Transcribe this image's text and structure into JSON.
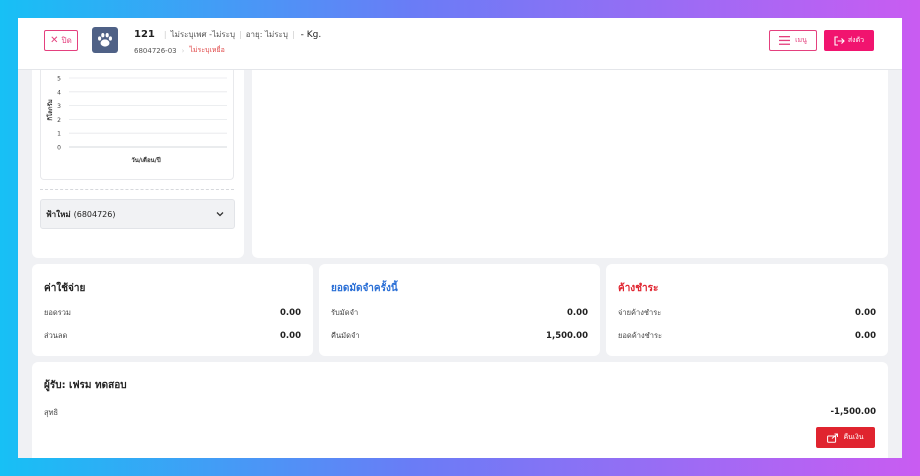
{
  "header": {
    "close_label": "ปิด",
    "pet_number": "121",
    "pet_gender": "ไม่ระบุเพศ -ไม่ระบุ",
    "pet_age": "อายุ: ไม่ระบุ",
    "pet_weight": "- Kg.",
    "pet_code": "6804726-03",
    "pet_status": "ไม่ระบุเหยื่อ",
    "menu_label": "เมนู",
    "send_label": "ส่งตัว"
  },
  "weight_chart": {
    "ylabel": "กิโลกรัม",
    "xlabel": "วัน/เดือน/ปี",
    "ticks": [
      "5",
      "4",
      "3",
      "2",
      "1",
      "0"
    ]
  },
  "chart_data": {
    "type": "line",
    "title": "",
    "xlabel": "วัน/เดือน/ปี",
    "ylabel": "กิโลกรัม",
    "ylim": [
      0,
      5
    ],
    "yticks": [
      0,
      1,
      2,
      3,
      4,
      5
    ],
    "grid": true,
    "series": []
  },
  "owner": {
    "name": "ฟ้าใหม่",
    "code": "(6804726)"
  },
  "expenses": {
    "title": "ค่าใช้จ่าย",
    "rows": [
      {
        "label": "ยอดรวม",
        "value": "0.00"
      },
      {
        "label": "ส่วนลด",
        "value": "0.00"
      }
    ]
  },
  "deposit": {
    "title": "ยอดมัดจำครั้งนี้",
    "rows": [
      {
        "label": "รับมัดจำ",
        "value": "0.00"
      },
      {
        "label": "คืนมัดจำ",
        "value": "1,500.00"
      }
    ]
  },
  "outstanding": {
    "title": "ค้างชำระ",
    "rows": [
      {
        "label": "จ่ายค้างชำระ",
        "value": "0.00"
      },
      {
        "label": "ยอดค้างชำระ",
        "value": "0.00"
      }
    ]
  },
  "receiver": {
    "title": "ผู้รับ: เฟรม ทดสอบ",
    "net_label": "สุทธิ",
    "net_value": "-1,500.00",
    "refund_label": "คืนเงิน"
  },
  "colors": {
    "accent": "#f1146f",
    "deposit_title": "#2a6fd6",
    "outstanding_title": "#e0242f",
    "refund": "#e0242f"
  }
}
